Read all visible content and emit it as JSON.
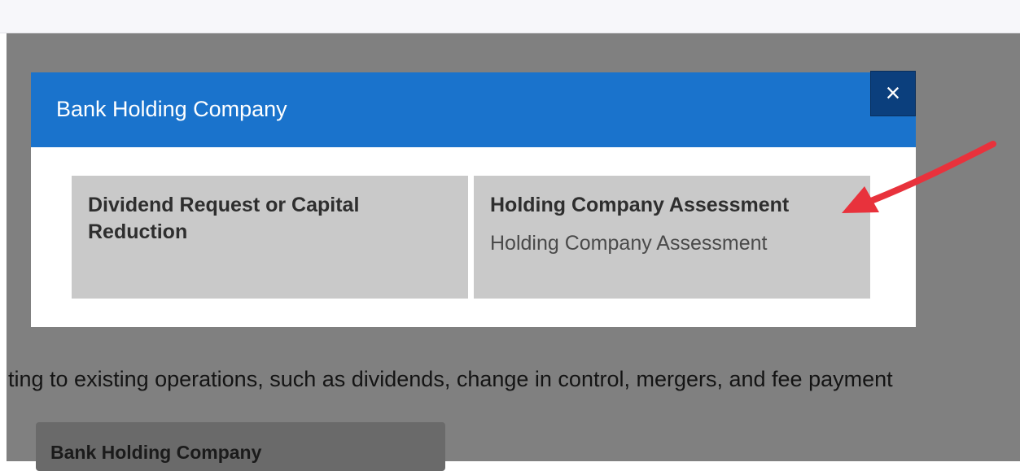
{
  "modal": {
    "title": "Bank Holding Company",
    "close_label": "×",
    "options": [
      {
        "title": "Dividend Request or Capital Reduction",
        "description": ""
      },
      {
        "title": "Holding Company Assessment",
        "description": "Holding Company Assessment"
      }
    ]
  },
  "background": {
    "description_text": "ting to existing operations, such as dividends, change in control, mergers, and fee payment",
    "card_title": "Bank Holding Company"
  },
  "colors": {
    "modal_header": "#1a73cc",
    "close_button": "#0b3f7d",
    "option_card": "#c9c9c9",
    "overlay": "#808080",
    "annotation_arrow": "#e8323c"
  },
  "annotation": {
    "icon": "red-arrow-icon"
  }
}
